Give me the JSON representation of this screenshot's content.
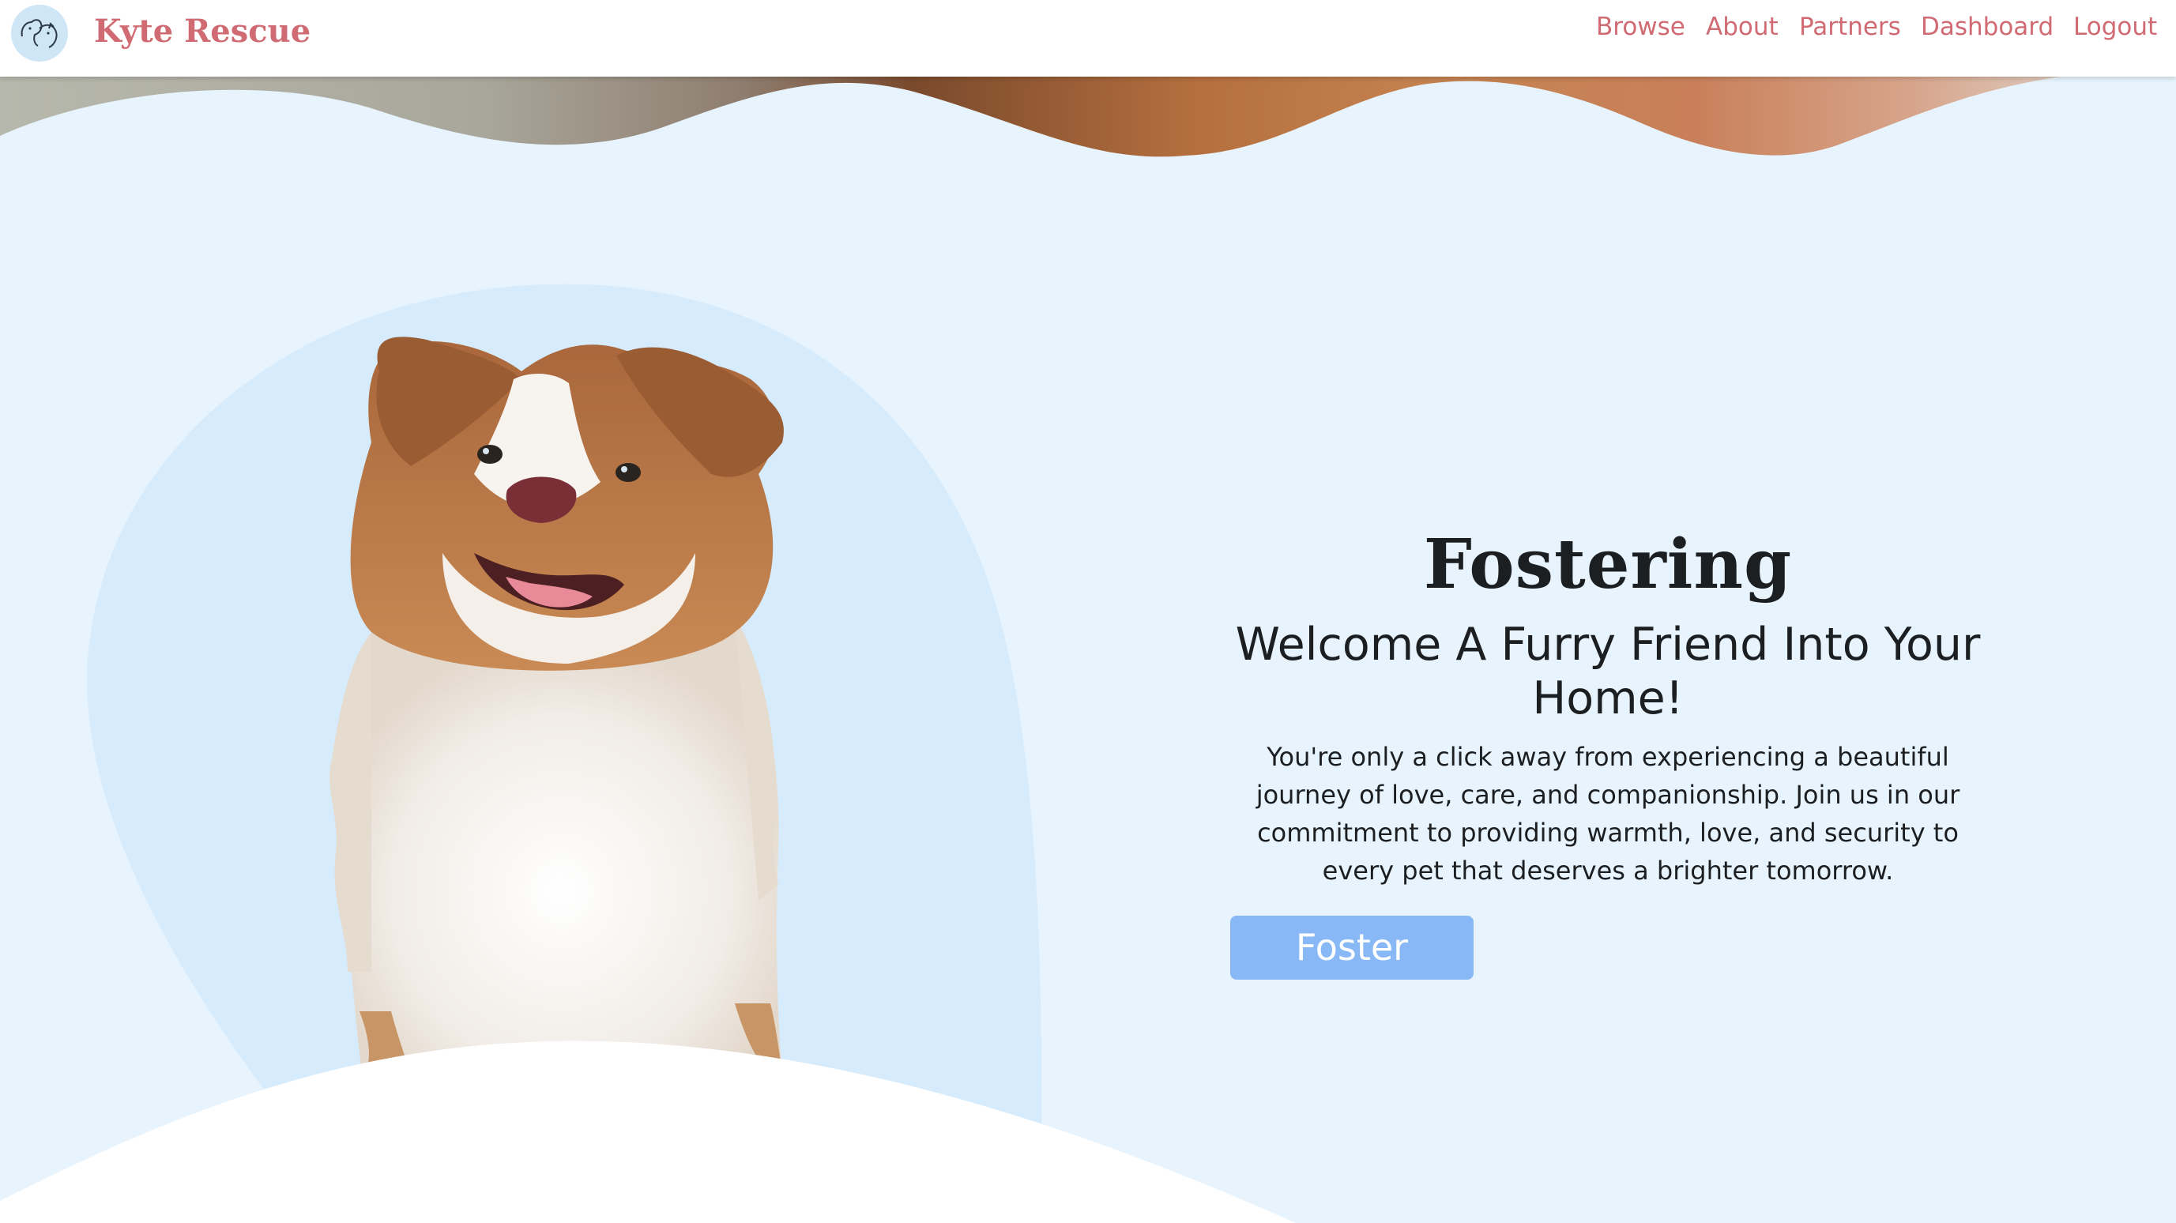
{
  "brand": {
    "name": "Kyte Rescue",
    "logo_icon": "dog-cat-logo-icon"
  },
  "nav": {
    "items": [
      {
        "label": "Browse"
      },
      {
        "label": "About"
      },
      {
        "label": "Partners"
      },
      {
        "label": "Dashboard"
      },
      {
        "label": "Logout"
      }
    ]
  },
  "hero": {
    "title": "Fostering",
    "subtitle": "Welcome A Furry Friend Into Your Home!",
    "body": "You're only a click away from experiencing a beautiful journey of love, care, and companionship. Join us in our commitment to providing warmth, love, and security to every pet that deserves a brighter tomorrow.",
    "cta_label": "Foster",
    "image": "australian-shepherd-dog-photo"
  },
  "colors": {
    "background": "#e8f4fd",
    "blob": "#d6ebfb",
    "brand_pink": "#d06b74",
    "button": "#89b8f6",
    "text": "#1c1f22"
  }
}
